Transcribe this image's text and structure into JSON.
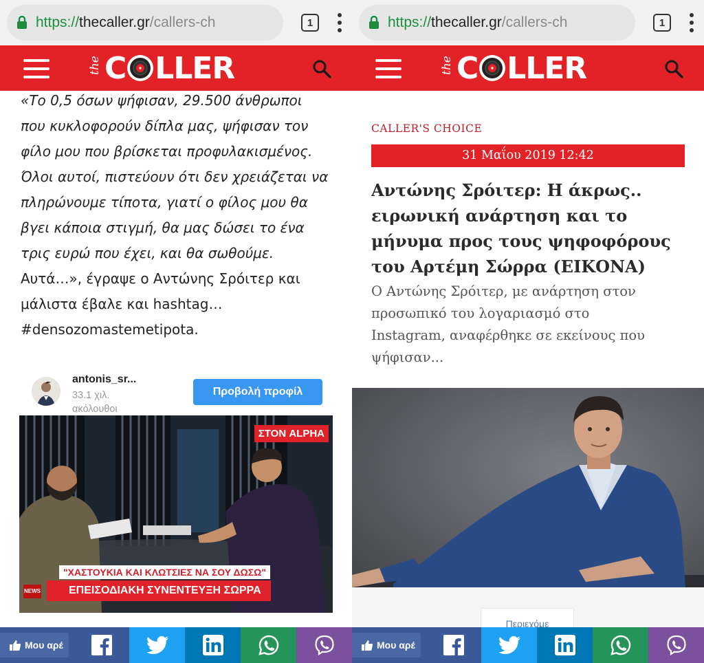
{
  "browser": {
    "url_https": "https://",
    "url_domain": "thecaller.gr",
    "url_path": "/callers-ch",
    "tab_count": "1"
  },
  "site": {
    "logo_prefix": "the",
    "logo_text_before": "C",
    "logo_text_after": "LLER",
    "brand_color": "#e32228"
  },
  "left": {
    "quote_lines": [
      "«Το 0,5 όσων ψήφισαν, 29.500 άνθρωποι",
      "που κυκλοφορούν δίπλα μας, ψήφισαν τον",
      "φίλο μου που βρίσκεται προφυλακισμένος.",
      "Όλοι αυτοί, πιστεύουν ότι δεν χρειάζεται να",
      "πληρώνουμε τίποτα, γιατί ο φίλος μου θα",
      "βγει κάποια στιγμή, θα μας δώσει το ένα",
      "τρις ευρώ που έχει, και θα σωθούμε.",
      "Αυτά…», έγραψε ο Αντώνης Σρόιτερ και",
      "μάλιστα έβαλε και hashtag…",
      "#densozomastemetipota."
    ],
    "instagram": {
      "username": "antonis_sr...",
      "followers": "33.1 χιλ. ακόλουθοι",
      "view_profile": "Προβολή προφίλ"
    },
    "video": {
      "badge": "ΣΤΟΝ ALPHA",
      "caption_top": "\"ΧΑΣΤΟΥΚΙΑ ΚΑΙ ΚΛΩΤΣΙΕΣ ΝΑ ΣΟΥ ΔΩΣΩ\"",
      "caption_bottom": "ΕΠΕΙΣΟΔΙΑΚΗ ΣΥΝΕΝΤΕΥΞΗ ΣΩΡΡΑ",
      "news_tag": "NEWS"
    }
  },
  "right": {
    "kicker": "CALLER'S CHOICE",
    "date": "31 Μαΐου 2019 12:42",
    "headline_lines": [
      "Αντώνης Σρόιτερ: Η άκρως..",
      "ειρωνική ανάρτηση και το",
      "μήνυμα προς τους ψηφοφόρους",
      "του Αρτέμη Σώρρα (ΕΙΚΟΝΑ)"
    ],
    "summary_lines": [
      "Ο Αντώνης Σρόιτερ, με ανάρτηση στον",
      "προσωπικό του λογαριασμό στο",
      "Instagram, αναφέρθηκε σε εκείνους που",
      "ψήφισαν..."
    ],
    "more_label": "Περιεχόμε"
  },
  "share_bar": {
    "like_label": "Μου αρέ",
    "icons": [
      "facebook-icon",
      "twitter-icon",
      "linkedin-icon",
      "whatsapp-icon",
      "viber-icon"
    ]
  }
}
